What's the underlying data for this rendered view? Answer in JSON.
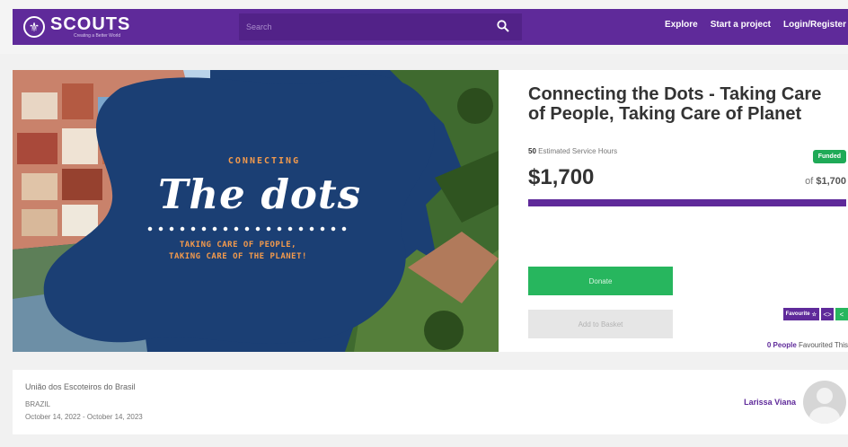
{
  "header": {
    "brand": "SCOUTS",
    "brand_tagline": "Creating a Better World",
    "search_placeholder": "Search",
    "nav": [
      "Explore",
      "Start a project",
      "Login/Register"
    ]
  },
  "hero": {
    "kicker": "CONNECTING",
    "title": "The dots",
    "subtitle_line1": "TAKING CARE OF PEOPLE,",
    "subtitle_line2": "TAKING CARE OF THE PLANET!"
  },
  "project": {
    "title": "Connecting the Dots - Taking Care of People, Taking Care of Planet",
    "service_hours": "50",
    "service_hours_label": "Estimated Service Hours",
    "status_badge": "Funded",
    "raised": "$1,700",
    "goal_prefix": "of",
    "goal": "$1,700",
    "progress_fraction": 1.0,
    "donate_label": "Donate",
    "basket_label": "Add to Basket",
    "favourite_label": "Favourite",
    "fav_count": "0 People",
    "fav_count_suffix": "Favourited This"
  },
  "org": {
    "name": "União dos Escoteiros do Brasil",
    "country": "BRAZIL",
    "dates": "October 14, 2022 - October 14, 2023",
    "leader": "Larissa Viana"
  },
  "colors": {
    "brand_purple": "#5f2a9a",
    "success_green": "#27b65e"
  }
}
